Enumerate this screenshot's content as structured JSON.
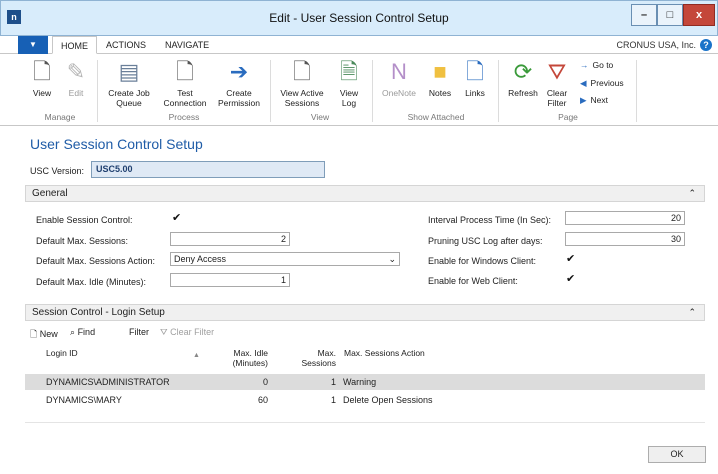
{
  "window": {
    "title": "Edit - User Session Control Setup"
  },
  "ribbon_tabs": {
    "home": "HOME",
    "actions": "ACTIONS",
    "navigate": "NAVIGATE",
    "company": "CRONUS USA, Inc."
  },
  "ribbon": {
    "view": "View",
    "edit": "Edit",
    "create_job_queue_1": "Create Job",
    "create_job_queue_2": "Queue",
    "test_connection_1": "Test",
    "test_connection_2": "Connection",
    "create_permission_1": "Create",
    "create_permission_2": "Permission",
    "view_active_sessions_1": "View Active",
    "view_active_sessions_2": "Sessions",
    "view_log_1": "View",
    "view_log_2": "Log",
    "onenote": "OneNote",
    "notes": "Notes",
    "links": "Links",
    "refresh": "Refresh",
    "clear_filter_1": "Clear",
    "clear_filter_2": "Filter",
    "go_to": "Go to",
    "previous": "Previous",
    "next": "Next",
    "group_manage": "Manage",
    "group_process": "Process",
    "group_view": "View",
    "group_show_attached": "Show Attached",
    "group_page": "Page"
  },
  "page": {
    "title": "User Session Control Setup",
    "usc_version_label": "USC Version:",
    "usc_version_value": "USC5.00"
  },
  "general": {
    "header": "General",
    "enable_session_control_label": "Enable Session Control:",
    "enable_session_control": true,
    "default_max_sessions_label": "Default Max. Sessions:",
    "default_max_sessions": "2",
    "default_max_sessions_action_label": "Default Max. Sessions Action:",
    "default_max_sessions_action": "Deny Access",
    "default_max_idle_label": "Default Max. Idle (Minutes):",
    "default_max_idle": "1",
    "interval_process_time_label": "Interval Process Time (In Sec):",
    "interval_process_time": "20",
    "pruning_usc_log_label": "Pruning USC Log after days:",
    "pruning_usc_log": "30",
    "enable_windows_client_label": "Enable for Windows Client:",
    "enable_windows_client": true,
    "enable_web_client_label": "Enable for Web Client:",
    "enable_web_client": true
  },
  "login_setup": {
    "header": "Session Control - Login Setup",
    "toolbar": {
      "new": "New",
      "find": "Find",
      "filter": "Filter",
      "clear_filter": "Clear Filter"
    },
    "columns": {
      "login_id": "Login ID",
      "max_idle_1": "Max. Idle",
      "max_idle_2": "(Minutes)",
      "max_sessions_1": "Max.",
      "max_sessions_2": "Sessions",
      "max_sessions_action": "Max. Sessions Action"
    },
    "rows": [
      {
        "login_id": "DYNAMICS\\ADMINISTRATOR",
        "max_idle": "0",
        "max_sessions": "1",
        "action": "Warning"
      },
      {
        "login_id": "DYNAMICS\\MARY",
        "max_idle": "60",
        "max_sessions": "1",
        "action": "Delete Open Sessions"
      }
    ]
  },
  "footer": {
    "ok": "OK"
  }
}
